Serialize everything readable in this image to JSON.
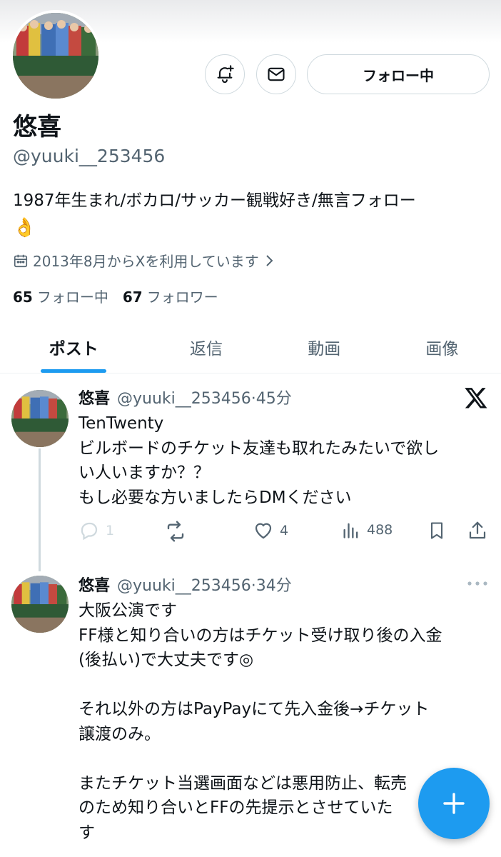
{
  "profile": {
    "display_name": "悠喜",
    "handle": "@yuuki__253456",
    "bio": "1987年生まれ/ボカロ/サッカー観戦好き/無言フォロー",
    "bio_emoji": "👌",
    "joined": "2013年8月からXを利用しています",
    "following_count": "65",
    "following_label": "フォロー中",
    "followers_count": "67",
    "followers_label": "フォロワー",
    "follow_button": "フォロー中"
  },
  "tabs": [
    {
      "label": "ポスト",
      "active": true
    },
    {
      "label": "返信",
      "active": false
    },
    {
      "label": "動画",
      "active": false
    },
    {
      "label": "画像",
      "active": false
    }
  ],
  "tweets": [
    {
      "name": "悠喜",
      "handle": "@yuuki__253456",
      "time": "·45分",
      "text": "TenTwenty\nビルボードのチケット友達も取れたみたいで欲し\nい人いますか？？\nもし必要な方いましたらDMください",
      "replies": "1",
      "retweets": "",
      "likes": "4",
      "views": "488"
    },
    {
      "name": "悠喜",
      "handle": "@yuuki__253456",
      "time": "·34分",
      "text": "大阪公演です\nFF様と知り合いの方はチケット受け取り後の入金\n(後払い)で大丈夫です◎\n\nそれ以外の方はPayPayにて先入金後→チケット\n譲渡のみ。\n\nまたチケット当選画面などは悪用防止、転売\nのため知り合いとFFの先提示とさせていた\nす"
    }
  ],
  "colors": {
    "accent": "#1d9bf0",
    "text": "#0f1419",
    "secondary": "#536471",
    "border": "#cfd9de"
  },
  "icons": {
    "notify": "bell-plus-icon",
    "message": "envelope-icon",
    "calendar": "calendar-icon",
    "chevron": "chevron-right-icon",
    "brand": "x-logo-icon",
    "more": "more-dots-icon",
    "compose": "plus-icon"
  }
}
